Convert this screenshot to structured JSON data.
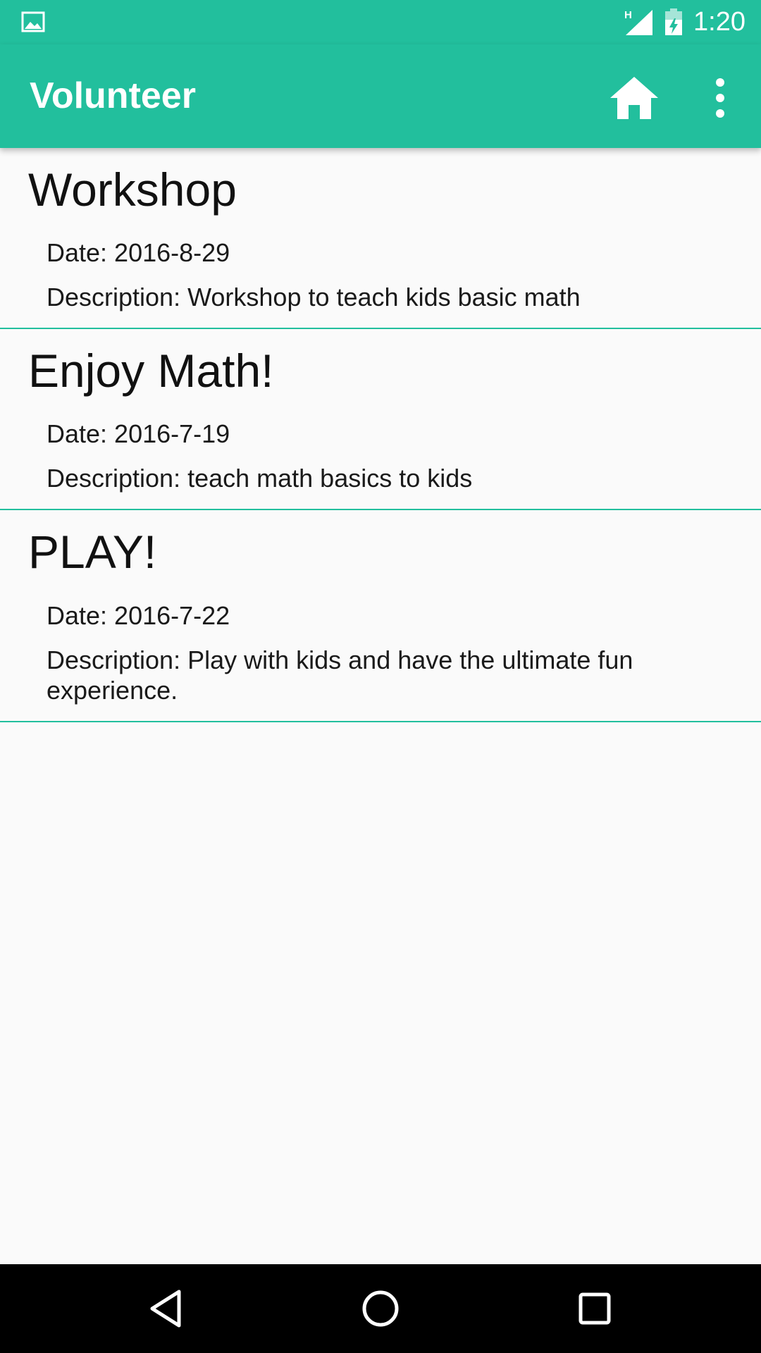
{
  "status_bar": {
    "time": "1:20",
    "network_label": "H",
    "icons": [
      "image-icon",
      "signal-icon",
      "battery-icon"
    ]
  },
  "app_bar": {
    "title": "Volunteer",
    "icons": [
      "home-icon",
      "more-vert-icon"
    ]
  },
  "events": [
    {
      "title": "Workshop",
      "date": "Date: 2016-8-29",
      "description": "Description: Workshop to teach kids basic math"
    },
    {
      "title": "Enjoy Math!",
      "date": "Date: 2016-7-19",
      "description": "Description: teach math basics to kids"
    },
    {
      "title": "PLAY!",
      "date": "Date: 2016-7-22",
      "description": "Description: Play with kids and have the ultimate fun experience."
    }
  ],
  "nav_bar": {
    "icons": [
      "back-icon",
      "home-circle-icon",
      "recents-icon"
    ]
  },
  "colors": {
    "primary": "#22bf9d",
    "background": "#fafafa",
    "divider": "#22bf9d",
    "nav_background": "#000000"
  }
}
